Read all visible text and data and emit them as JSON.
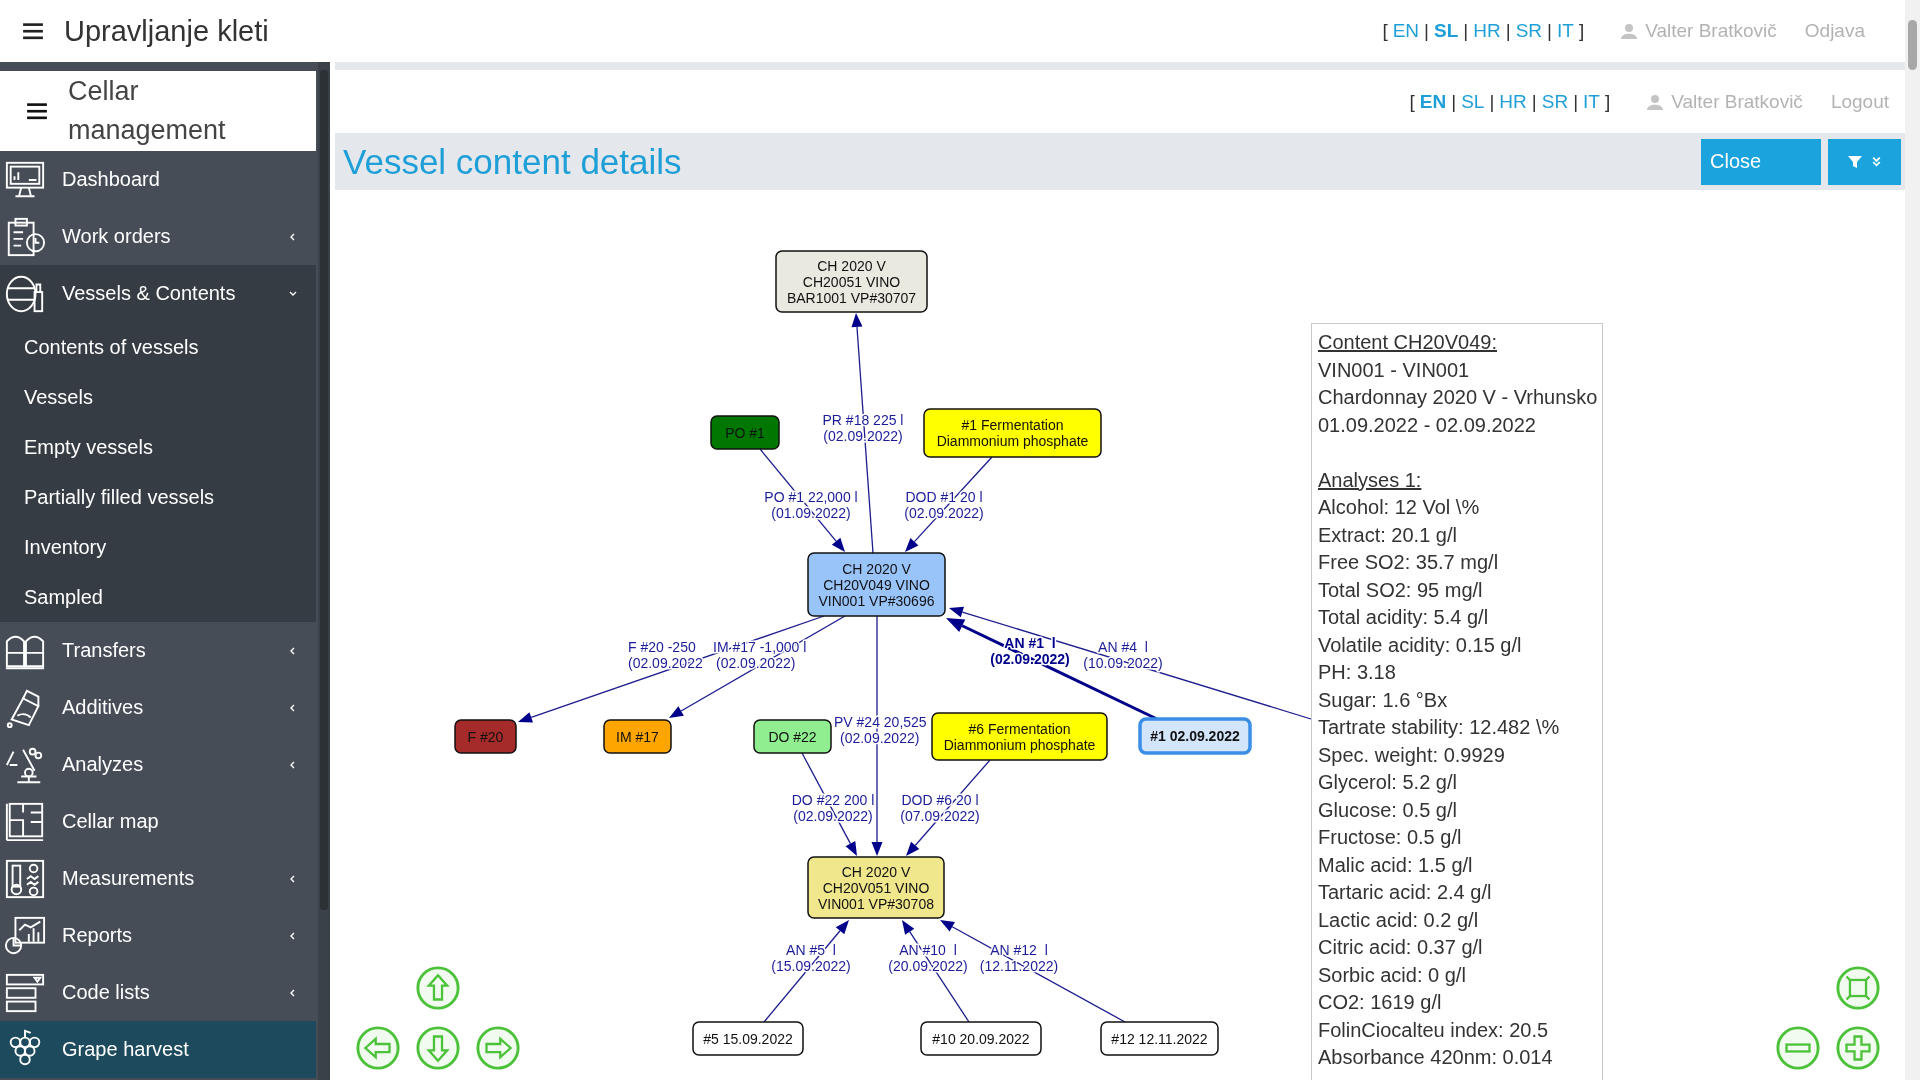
{
  "app_bar": {
    "title": "Upravljanje kleti",
    "brackets": [
      "[",
      "]"
    ],
    "separators": [
      "|",
      "|",
      "|",
      "|"
    ],
    "languages": [
      {
        "code": "EN",
        "selected": false
      },
      {
        "code": "SL",
        "selected": true
      },
      {
        "code": "HR",
        "selected": false
      },
      {
        "code": "SR",
        "selected": false
      },
      {
        "code": "IT",
        "selected": false
      }
    ],
    "user": "Valter Bratkovič",
    "logout": "Odjava"
  },
  "sidebar": {
    "title": "Cellar management",
    "items": [
      {
        "label": "Dashboard",
        "kind": "link",
        "selected": false
      },
      {
        "label": "Work orders",
        "kind": "group",
        "expanded": false,
        "selected": false
      },
      {
        "label": "Vessels & Contents",
        "kind": "group",
        "expanded": true,
        "selected": false,
        "children": [
          {
            "label": "Contents of vessels"
          },
          {
            "label": "Vessels"
          },
          {
            "label": "Empty vessels"
          },
          {
            "label": "Partially filled vessels"
          },
          {
            "label": "Inventory"
          },
          {
            "label": "Sampled"
          }
        ]
      },
      {
        "label": "Transfers",
        "kind": "group",
        "expanded": false,
        "selected": false
      },
      {
        "label": "Additives",
        "kind": "group",
        "expanded": false,
        "selected": false
      },
      {
        "label": "Analyzes",
        "kind": "group",
        "expanded": false,
        "selected": false
      },
      {
        "label": "Cellar map",
        "kind": "link",
        "selected": false
      },
      {
        "label": "Measurements",
        "kind": "group",
        "expanded": false,
        "selected": false
      },
      {
        "label": "Reports",
        "kind": "group",
        "expanded": false,
        "selected": false
      },
      {
        "label": "Code lists",
        "kind": "group",
        "expanded": false,
        "selected": false
      },
      {
        "label": "Grape harvest",
        "kind": "link",
        "selected": true
      }
    ]
  },
  "header": {
    "brackets": [
      "[",
      "]"
    ],
    "separators": [
      "|",
      "|",
      "|",
      "|"
    ],
    "languages": [
      {
        "code": "EN",
        "selected": true
      },
      {
        "code": "SL",
        "selected": false
      },
      {
        "code": "HR",
        "selected": false
      },
      {
        "code": "SR",
        "selected": false
      },
      {
        "code": "IT",
        "selected": false
      }
    ],
    "user": "Valter Bratkovič",
    "logout": "Logout"
  },
  "page": {
    "title": "Vessel content details",
    "close_button": "Close"
  },
  "graph": {
    "nodes": [
      {
        "lines": [
          "CH 2020 V",
          "CH20051 VINO",
          "BAR1001 VP#30707"
        ],
        "color": "#e9e9df",
        "selected": false
      },
      {
        "lines": [
          "PO #1"
        ],
        "color": "#007700",
        "selected": false
      },
      {
        "lines": [
          "#1 Fermentation",
          "Diammonium phosphate"
        ],
        "color": "#ffff00",
        "selected": false
      },
      {
        "lines": [
          "CH 2020 V",
          "CH20V049 VINO",
          "VIN001 VP#30696"
        ],
        "color": "#99c4fa",
        "selected": false
      },
      {
        "lines": [
          "F #20"
        ],
        "color": "#a52a2a",
        "selected": false
      },
      {
        "lines": [
          "IM #17"
        ],
        "color": "#ffa500",
        "selected": false
      },
      {
        "lines": [
          "DO #22"
        ],
        "color": "#90ee90",
        "selected": false
      },
      {
        "lines": [
          "#6 Fermentation",
          "Diammonium phosphate"
        ],
        "color": "#ffff00",
        "selected": false
      },
      {
        "lines": [
          "#1 02.09.2022"
        ],
        "color": "#d3e5fb",
        "selected": true
      },
      {
        "lines": [
          "CH 2020 V",
          "CH20V051 VINO",
          "VIN001 VP#30708"
        ],
        "color": "#f0e68c",
        "selected": false
      },
      {
        "lines": [
          "#5 15.09.2022"
        ],
        "selected": false
      },
      {
        "lines": [
          "#10 20.09.2022"
        ],
        "selected": false
      },
      {
        "lines": [
          "#12 12.11.2022"
        ],
        "selected": false
      }
    ],
    "edges": [
      {
        "label": [
          "PR #18 225 l",
          "(02.09.2022)"
        ],
        "highlighted": false
      },
      {
        "label": [
          "PO #1 22,000 l",
          "(01.09.2022)"
        ],
        "highlighted": false
      },
      {
        "label": [
          "DOD #1 20 l",
          "(02.09.2022)"
        ],
        "highlighted": false
      },
      {
        "label": [
          "F #20 -250",
          "(02.09.2022"
        ],
        "highlighted": false
      },
      {
        "label": [
          "IM #17 -1,000 l",
          "(02.09.2022)"
        ],
        "highlighted": false
      },
      {
        "label": [
          "PV #24 20,525",
          "(02.09.2022)"
        ],
        "highlighted": false
      },
      {
        "label": [
          "DO #22 200 l",
          "(02.09.2022)"
        ],
        "highlighted": false
      },
      {
        "label": [
          "DOD #6 20 l",
          "(07.09.2022)"
        ],
        "highlighted": false
      },
      {
        "label": [
          "AN #1  l",
          "(02.09.2022)"
        ],
        "highlighted": true
      },
      {
        "label": [
          "AN #4  l",
          "(10.09.2022)"
        ],
        "highlighted": false
      },
      {
        "label": [
          "AN #5  l",
          "(15.09.2022)"
        ],
        "highlighted": false
      },
      {
        "label": [
          "AN #10  l",
          "(20.09.2022)"
        ],
        "highlighted": false
      },
      {
        "label": [
          "AN #12  l",
          "(12.11.2022)"
        ],
        "highlighted": false
      }
    ]
  },
  "info_panel": {
    "heading": "Content CH20V049:",
    "lines": [
      "VIN001 - VIN001",
      "Chardonnay 2020 V - Vrhunsko",
      "01.09.2022 - 02.09.2022"
    ],
    "analyses_heading": "Analyses 1:",
    "analyses": [
      "Alcohol: 12 Vol \\%",
      "Extract: 20.1 g/l",
      "Free SO2: 35.7 mg/l",
      "Total SO2: 95 mg/l",
      "Total acidity: 5.4 g/l",
      "Volatile acidity: 0.15 g/l",
      "PH: 3.18",
      "Sugar: 1.6 °Bx",
      "Tartrate stability: 12.482 \\%",
      "Spec. weight: 0.9929",
      "Glycerol: 5.2 g/l",
      "Glucose: 0.5 g/l",
      "Fructose: 0.5 g/l",
      "Malic acid: 1.5 g/l",
      "Tartaric acid: 2.4 g/l",
      "Lactic acid: 0.2 g/l",
      "Citric acid: 0.37 g/l",
      "Sorbic acid: 0 g/l",
      "CO2: 1619 g/l",
      "FolinCiocalteu index: 20.5",
      "Absorbance 420nm: 0.014"
    ]
  }
}
